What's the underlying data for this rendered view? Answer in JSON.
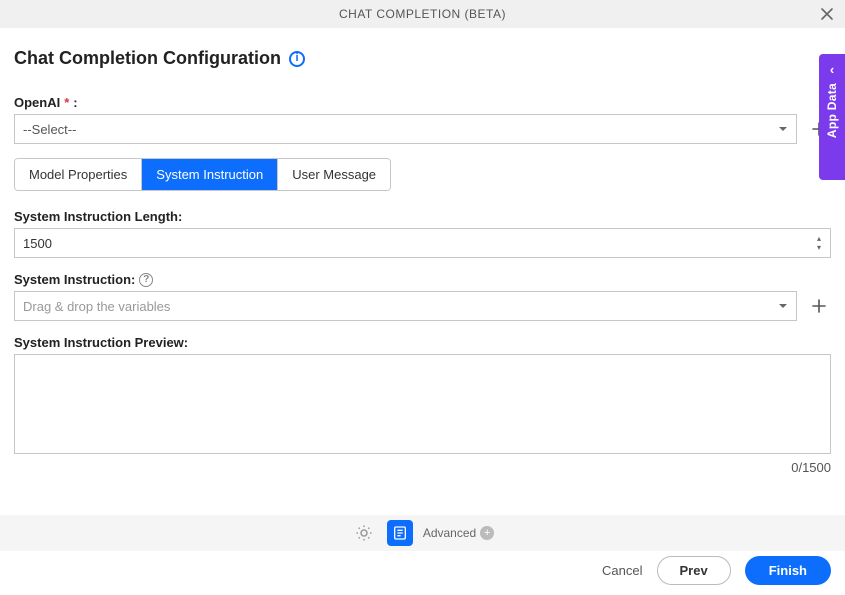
{
  "header": {
    "title": "CHAT COMPLETION (BETA)"
  },
  "page_title": "Chat Completion Configuration",
  "side_panel": {
    "label": "App Data"
  },
  "openai": {
    "label": "OpenAI",
    "required_glyph": "*",
    "colon": ":",
    "selected": "--Select--"
  },
  "tabs": [
    {
      "label": "Model Properties",
      "active": false
    },
    {
      "label": "System Instruction",
      "active": true
    },
    {
      "label": "User Message",
      "active": false
    }
  ],
  "length_field": {
    "label": "System Instruction Length:",
    "value": "1500"
  },
  "instruction_field": {
    "label": "System Instruction:",
    "placeholder": "Drag & drop the variables"
  },
  "preview_field": {
    "label": "System Instruction Preview:",
    "value": "",
    "counter": "0/1500"
  },
  "footer": {
    "advanced_label": "Advanced"
  },
  "actions": {
    "cancel": "Cancel",
    "prev": "Prev",
    "finish": "Finish"
  }
}
